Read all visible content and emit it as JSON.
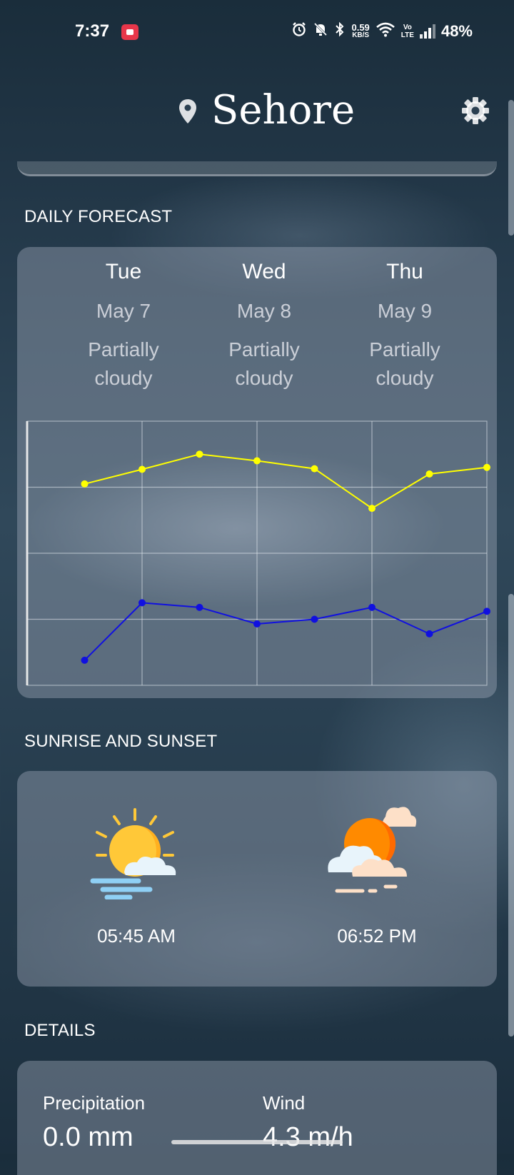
{
  "status_bar": {
    "time": "7:37",
    "net_speed_value": "0.59",
    "net_speed_unit": "KB/S",
    "volte_top": "Vo",
    "volte_bottom": "LTE",
    "battery": "48%"
  },
  "header": {
    "city": "Sehore"
  },
  "sections": {
    "daily_forecast": "DAILY FORECAST",
    "sunrise_sunset": "SUNRISE AND SUNSET",
    "details": "DETAILS"
  },
  "forecast": {
    "days": [
      {
        "day": "Tue",
        "date": "May 7",
        "condition_line1": "Partially",
        "condition_line2": "cloudy"
      },
      {
        "day": "Wed",
        "date": "May 8",
        "condition_line1": "Partially",
        "condition_line2": "cloudy"
      },
      {
        "day": "Thu",
        "date": "May 9",
        "condition_line1": "Partially",
        "condition_line2": "cloudy"
      }
    ]
  },
  "chart_data": {
    "type": "line",
    "x": [
      1,
      2,
      3,
      4,
      5,
      6,
      7,
      8
    ],
    "xlim": [
      0,
      8
    ],
    "ylim": [
      0,
      4
    ],
    "grid": true,
    "series": [
      {
        "color": "#ffff00",
        "values": [
          3.05,
          3.27,
          3.5,
          3.4,
          3.28,
          2.68,
          3.2,
          3.3
        ]
      },
      {
        "color": "#1010e0",
        "values": [
          0.38,
          1.25,
          1.18,
          0.93,
          1.0,
          1.18,
          0.78,
          1.12
        ]
      }
    ]
  },
  "sun": {
    "sunrise_time": "05:45 AM",
    "sunset_time": "06:52 PM",
    "sunrise_icon": "sunrise-icon",
    "sunset_icon": "sunset-icon"
  },
  "details": {
    "precipitation_label": "Precipitation",
    "precipitation_value": "0.0 mm",
    "wind_label": "Wind",
    "wind_value": "4.3 m/h"
  }
}
